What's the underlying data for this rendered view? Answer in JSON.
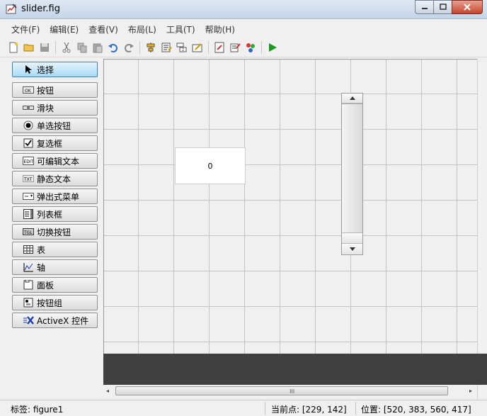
{
  "window": {
    "title": "slider.fig"
  },
  "menu": [
    "文件(F)",
    "编辑(E)",
    "查看(V)",
    "布局(L)",
    "工具(T)",
    "帮助(H)"
  ],
  "toolbar": [
    {
      "icon": "new-icon"
    },
    {
      "icon": "open-icon"
    },
    {
      "icon": "save-icon"
    },
    {
      "icon": "cut-icon"
    },
    {
      "icon": "copy-icon"
    },
    {
      "icon": "paste-icon"
    },
    {
      "icon": "undo-icon"
    },
    {
      "icon": "redo-icon"
    },
    {
      "icon": "align-icon"
    },
    {
      "icon": "menu-editor-icon"
    },
    {
      "icon": "tab-order-icon"
    },
    {
      "icon": "toolbar-editor-icon"
    },
    {
      "icon": "m-file-editor-icon"
    },
    {
      "icon": "property-inspector-icon"
    },
    {
      "icon": "object-browser-icon"
    },
    {
      "icon": "run-icon",
      "color": "#1a9a1a"
    }
  ],
  "palette": [
    {
      "label": "选择",
      "icon": "pointer-icon",
      "selected": true
    },
    {
      "label": "按钮",
      "icon": "pushbutton-icon"
    },
    {
      "label": "滑块",
      "icon": "slider-icon"
    },
    {
      "label": "单选按钮",
      "icon": "radio-icon"
    },
    {
      "label": "复选框",
      "icon": "checkbox-icon"
    },
    {
      "label": "可编辑文本",
      "icon": "edit-text-icon"
    },
    {
      "label": "静态文本",
      "icon": "static-text-icon"
    },
    {
      "label": "弹出式菜单",
      "icon": "popup-menu-icon"
    },
    {
      "label": "列表框",
      "icon": "listbox-icon"
    },
    {
      "label": "切换按钮",
      "icon": "toggle-icon"
    },
    {
      "label": "表",
      "icon": "table-icon"
    },
    {
      "label": "轴",
      "icon": "axes-icon"
    },
    {
      "label": "面板",
      "icon": "panel-icon"
    },
    {
      "label": "按钮组",
      "icon": "button-group-icon"
    },
    {
      "label": "ActiveX 控件",
      "icon": "activex-icon"
    }
  ],
  "canvas": {
    "edit_value": "0"
  },
  "hscroll": {
    "grip": "III"
  },
  "status": {
    "tag": "标签: figure1",
    "current_point": "当前点:  [229, 142]",
    "position": "位置: [520, 383, 560, 417]"
  }
}
